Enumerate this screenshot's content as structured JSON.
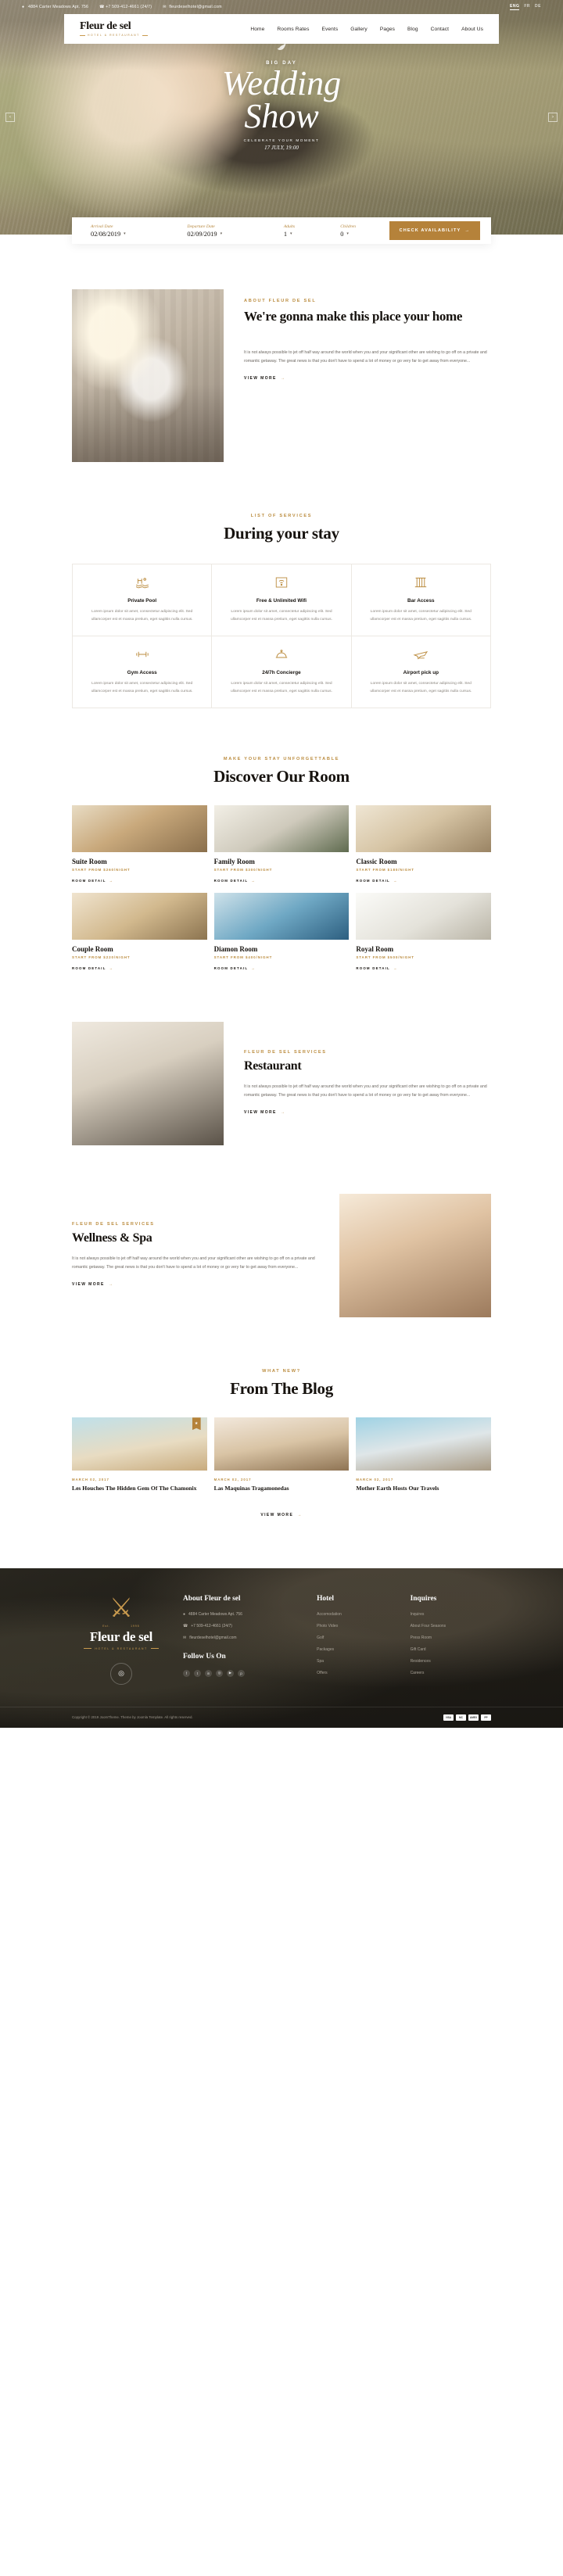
{
  "topbar": {
    "address": "4884 Carter Meadows Apt. 756",
    "phone": "+7 509-412-4661 (24/7)",
    "email": "fleurdeselhotel@gmail.com",
    "languages": [
      "ENG",
      "FR",
      "DE"
    ],
    "active_language": "ENG"
  },
  "brand": {
    "name": "Fleur de sel",
    "tagline": "HOTEL & RESTAURANT"
  },
  "nav": {
    "items": [
      "Home",
      "Rooms Rates",
      "Events",
      "Gallery",
      "Pages",
      "Blog",
      "Contact",
      "About Us"
    ]
  },
  "hero": {
    "kicker": "BIG DAY",
    "title_line1": "Wedding",
    "title_line2": "Show",
    "subtitle": "CELEBRATE YOUR MOMENT",
    "date": "17 JULY, 19:00",
    "prev": "‹",
    "next": "›"
  },
  "booking": {
    "arrival_label": "Arrival Date",
    "arrival_value": "02/08/2019",
    "departure_label": "Departure Date",
    "departure_value": "02/09/2019",
    "adults_label": "Adults",
    "adults_value": "1",
    "children_label": "Children",
    "children_value": "0",
    "button": "CHECK AVAILABILITY"
  },
  "about": {
    "kicker": "ABOUT FLEUR DE SEL",
    "heading": "We're gonna make this place your home",
    "paragraph": "It is not always possible to jet off half way around the world when you and your significant other are wishing to go off on a private and romantic getaway. The great news is that you don't have to spend a lot of money or go very far to get away from everyone...",
    "more": "VIEW MORE"
  },
  "services": {
    "kicker": "LIST OF SERVICES",
    "heading": "During your stay",
    "desc": "Lorem ipsum dolor sit amet, consectetur adipiscing elit. Sed ullamcorper est et massa pretium, eget sagittis nulla cursus.",
    "items": [
      {
        "name": "Private Pool",
        "icon": "pool-icon"
      },
      {
        "name": "Free & Unlimited Wifi",
        "icon": "wifi-icon"
      },
      {
        "name": "Bar Access",
        "icon": "bar-icon"
      },
      {
        "name": "Gym Access",
        "icon": "gym-icon"
      },
      {
        "name": "24/7h Concierge",
        "icon": "concierge-icon"
      },
      {
        "name": "Airport pick up",
        "icon": "airport-icon"
      }
    ]
  },
  "rooms": {
    "kicker": "MAKE YOUR STAY UNFORGETTABLE",
    "heading": "Discover Our Room",
    "more": "ROOM DETAIL",
    "items": [
      {
        "name": "Suite Room",
        "price": "START FROM $260/NIGHT"
      },
      {
        "name": "Family Room",
        "price": "START FROM $300/NIGHT"
      },
      {
        "name": "Classic Room",
        "price": "START FROM $180/NIGHT"
      },
      {
        "name": "Couple Room",
        "price": "START FROM $220/NIGHT"
      },
      {
        "name": "Diamon Room",
        "price": "START FROM $400/NIGHT"
      },
      {
        "name": "Royal Room",
        "price": "START FROM $500/NIGHT"
      }
    ]
  },
  "restaurant": {
    "kicker": "FLEUR DE SEL SERVICES",
    "heading": "Restaurant",
    "paragraph": "It is not always possible to jet off half way around the world when you and your significant other are wishing to go off on a private and romantic getaway. The great news is that you don't have to spend a lot of money or go very far to get away from everyone...",
    "more": "VIEW MORE"
  },
  "spa": {
    "kicker": "FLEUR DE SEL SERVICES",
    "heading": "Wellness & Spa",
    "paragraph": "It is not always possible to jet off half way around the world when you and your significant other are wishing to go off on a private and romantic getaway. The great news is that you don't have to spend a lot of money or go very far to get away from everyone...",
    "more": "VIEW MORE"
  },
  "blog": {
    "kicker": "WHAT NEW?",
    "heading": "From The Blog",
    "more": "VIEW MORE",
    "posts": [
      {
        "date": "MARCH 02, 2017",
        "title": "Les Houches The Hidden Gem Of The Chamonix"
      },
      {
        "date": "MARCH 02, 2017",
        "title": "Las Maquinas Tragamonedas"
      },
      {
        "date": "MARCH 02, 2017",
        "title": "Mother Earth Hosts Our Travels"
      }
    ]
  },
  "footer": {
    "established": {
      "left": "Est.",
      "right": "1995"
    },
    "about": {
      "title": "About Fleur de sel",
      "address": "4884 Carter Meadows Apt. 756",
      "phone": "+7 509-412-4661 (24/7)",
      "email": "fleurdeselhotel@gmail.com",
      "follow_title": "Follow Us On",
      "socials": [
        "f",
        "t",
        "in",
        "◎",
        "▶",
        "p"
      ]
    },
    "hotel": {
      "title": "Hotel",
      "links": [
        "Accomodation",
        "Photo Video",
        "Golf",
        "Packages",
        "Spa",
        "Offers"
      ]
    },
    "inquires": {
      "title": "Inquires",
      "links": [
        "Inquires",
        "About Four Seasons",
        "Press Room",
        "Gift Card",
        "Residences",
        "Careers"
      ]
    },
    "copyright": "Copyright © 2019 JoomTheme. Theme by Joomla Template. All rights reserved.",
    "copyright_brand": "JoomTheme",
    "payments": [
      "VISA",
      "MC",
      "AMEX",
      "PP"
    ]
  }
}
